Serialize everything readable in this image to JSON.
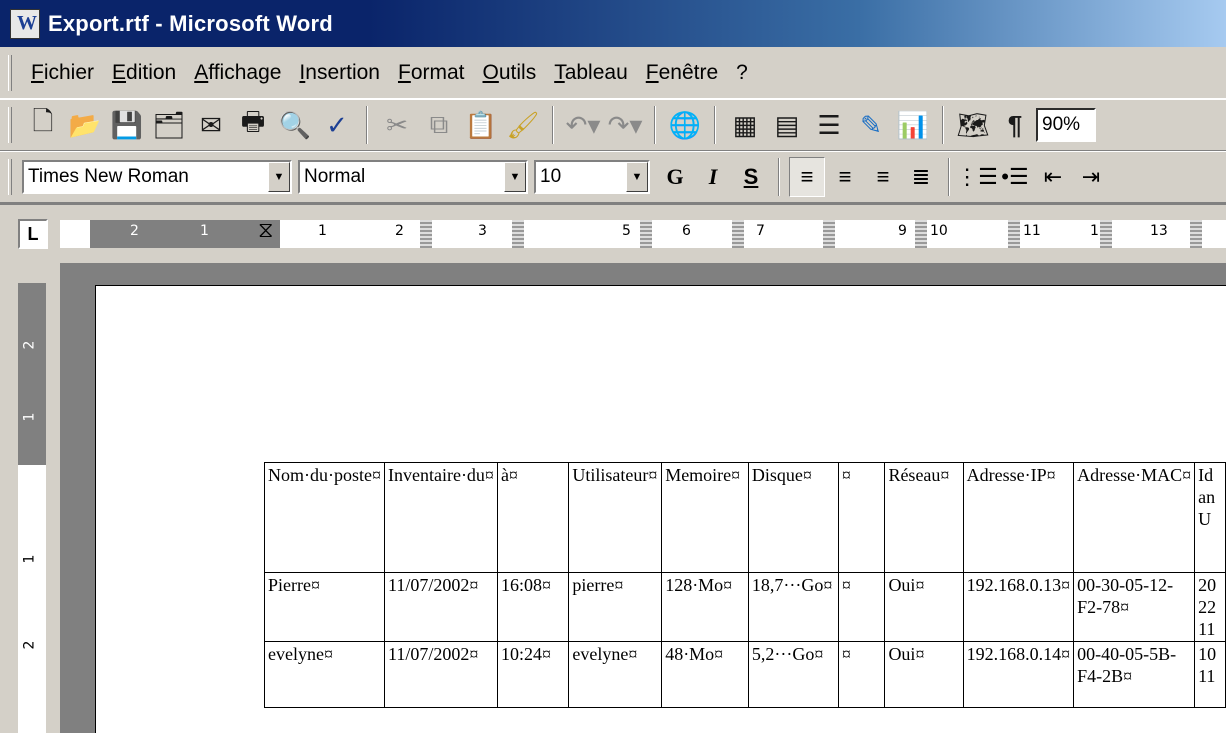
{
  "window": {
    "title": "Export.rtf - Microsoft Word"
  },
  "menu": [
    "Fichier",
    "Edition",
    "Affichage",
    "Insertion",
    "Format",
    "Outils",
    "Tableau",
    "Fenêtre",
    "?"
  ],
  "toolbar": {
    "zoom": "90%",
    "font": "Times New Roman",
    "style": "Normal",
    "size": "10",
    "bold": "G",
    "italic": "I",
    "underline": "S"
  },
  "ruler": {
    "tab_selector": "L",
    "h_labels": [
      "2",
      "1",
      "1",
      "2",
      "3",
      "5",
      "6",
      "7",
      "9",
      "10",
      "11",
      "1",
      "13"
    ],
    "v_labels": [
      "2",
      "1",
      "1",
      "2"
    ]
  },
  "table": {
    "headers": [
      "Nom·du·poste¤",
      "Inventaire·du¤",
      "à¤",
      "Utilisateur¤",
      "Memoire¤",
      "Disque¤",
      "¤",
      "Réseau¤",
      "Adresse·IP¤",
      "Adresse·MAC¤",
      "Id an U"
    ],
    "rows": [
      [
        "Pierre¤",
        "11/07/2002¤",
        "16:08¤",
        "pierre¤",
        "128·Mo¤",
        "18,7···Go¤",
        "¤",
        "Oui¤",
        "192.168.0.13¤",
        "00-30-05-12-F2-78¤",
        "20 22 11"
      ],
      [
        "evelyne¤",
        "11/07/2002¤",
        "10:24¤",
        "evelyne¤",
        "48·Mo¤",
        "5,2···Go¤",
        "¤",
        "Oui¤",
        "192.168.0.14¤",
        "00-40-05-5B-F4-2B¤",
        "10 11"
      ]
    ]
  }
}
